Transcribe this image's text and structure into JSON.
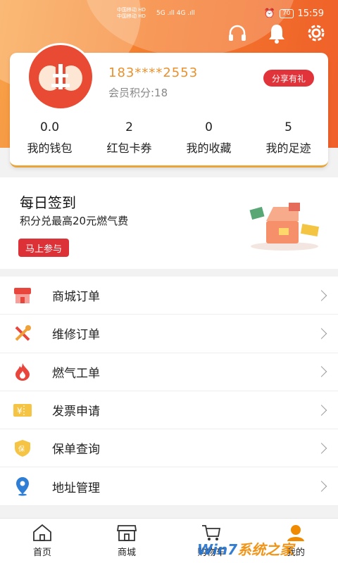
{
  "status_bar": {
    "carrier_1": "中国移动 HD",
    "carrier_2": "中国移动 HD",
    "signal": "5G .ıll 4G .ıll",
    "battery": "70",
    "time": "15:59"
  },
  "header_icons": [
    "headset-icon",
    "bell-icon",
    "gear-icon"
  ],
  "profile": {
    "phone": "183****2553",
    "points_label": "会员积分:18",
    "share_label": "分享有礼"
  },
  "stats": [
    {
      "value": "0.0",
      "label": "我的钱包"
    },
    {
      "value": "2",
      "label": "红包卡券"
    },
    {
      "value": "0",
      "label": "我的收藏"
    },
    {
      "value": "5",
      "label": "我的足迹"
    }
  ],
  "signin": {
    "title": "每日签到",
    "desc": "积分兑最高20元燃气费",
    "button": "马上参与"
  },
  "menu": [
    {
      "label": "商城订单",
      "icon": "store-icon"
    },
    {
      "label": "维修订单",
      "icon": "tools-icon"
    },
    {
      "label": "燃气工单",
      "icon": "flame-icon"
    },
    {
      "label": "发票申请",
      "icon": "invoice-icon"
    },
    {
      "label": "保单查询",
      "icon": "shield-icon"
    },
    {
      "label": "地址管理",
      "icon": "location-icon"
    }
  ],
  "tabs": [
    {
      "label": "首页",
      "icon": "home-icon"
    },
    {
      "label": "商城",
      "icon": "store-icon"
    },
    {
      "label": "购物车",
      "icon": "cart-icon"
    },
    {
      "label": "我的",
      "icon": "user-icon"
    }
  ],
  "watermark": {
    "part1": "Win7",
    "part2": "系统之家"
  },
  "colors": {
    "accent": "#f47b2c",
    "button_red": "#dd3138",
    "phone_text": "#e8912e"
  }
}
